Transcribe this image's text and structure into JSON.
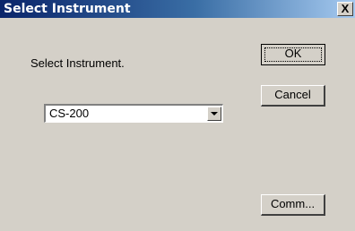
{
  "window": {
    "title": "Select Instrument",
    "close_symbol": "X"
  },
  "dialog": {
    "prompt": "Select Instrument.",
    "instrument_select": {
      "selected_value": "CS-200"
    },
    "buttons": {
      "ok_label": "OK",
      "cancel_label": "Cancel",
      "comm_label": "Comm..."
    }
  },
  "icons": {
    "dropdown": "chevron-down-icon",
    "close": "close-icon"
  }
}
